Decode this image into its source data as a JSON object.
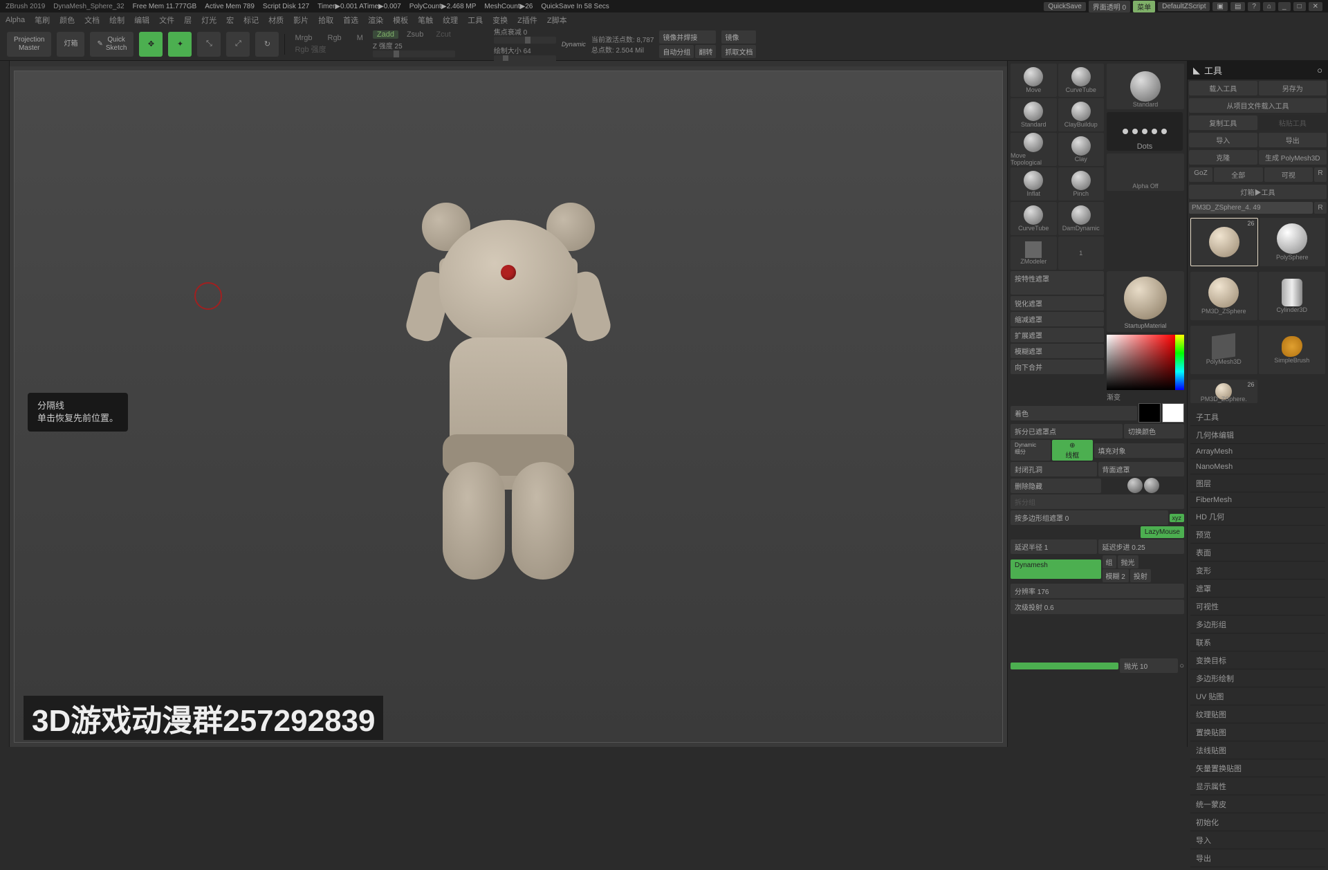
{
  "status": {
    "app": "ZBrush 2019",
    "doc": "DynaMesh_Sphere_32",
    "freemem": "Free Mem 11.777GB",
    "activemem": "Active Mem 789",
    "scratch": "Script Disk 127",
    "timer": "Timer▶0.001  ATime▶0.007",
    "polycount": "PolyCount▶2.468 MP",
    "meshcount": "MeshCount▶26",
    "quicksave": "QuickSave In 58 Secs",
    "quicksave_btn": "QuickSave",
    "transparent": "界面透明 0",
    "menu_btn": "菜单",
    "zscript": "DefaultZScript"
  },
  "menus": [
    "Alpha",
    "笔刷",
    "颜色",
    "文档",
    "绘制",
    "编辑",
    "文件",
    "层",
    "灯光",
    "宏",
    "标记",
    "材质",
    "影片",
    "拾取",
    "首选",
    "渲染",
    "模板",
    "笔触",
    "纹理",
    "工具",
    "变换",
    "Z插件",
    "Z脚本"
  ],
  "toolbar": {
    "projection": "Projection\nMaster",
    "lightbox": "灯箱",
    "quicksketch": "Quick\nSketch",
    "mrgb": "Mrgb",
    "rgb": "Rgb",
    "m": "M",
    "zadd": "Zadd",
    "zsub": "Zsub",
    "zcut": "Zcut",
    "rgb_intensity": "Rgb 强度",
    "z_intensity": "Z 强度 25",
    "focal": "焦点衰减 0",
    "drawsize": "绘制大小 64",
    "dynamic": "Dynamic",
    "activepoints": "当前激活点数: 8,787",
    "totalpoints": "总点数: 2.504 Mil",
    "mirror": "镜像并焊接",
    "autogroup": "自动分组",
    "flip": "翻转",
    "capture": "抓取文档",
    "mirror2": "镜像"
  },
  "tooltip": {
    "title": "分隔线",
    "desc": "单击恢复先前位置。"
  },
  "watermark": "3D游戏动漫群257292839",
  "brushes": {
    "row1a": "Move",
    "row1b": "CurveTube",
    "row2a": "Standard",
    "row2b": "ClayBuildup",
    "row3a": "Move Topological",
    "row3b": "Clay",
    "row4a": "Inflat",
    "row4b": "Pinch",
    "row5a": "CurveTube",
    "row5b": "DamDynamic",
    "row6a": "ZModeler",
    "row6b": "1",
    "standard": "Standard",
    "dots": "Dots",
    "alpha": "Alpha Off",
    "material": "StartupMaterial"
  },
  "mask_buttons": [
    "按特性遮罩",
    "锐化遮罩",
    "缩减遮罩",
    "扩展遮罩",
    "模糊遮罩",
    "向下合并"
  ],
  "rp1": {
    "gradient": "渐变",
    "tint": "着色",
    "split": "拆分已遮罩点",
    "switch": "切换颜色",
    "fill": "填充对象",
    "close_holes": "封闭孔洞",
    "del_hidden": "删除隐藏",
    "back_mask": "背面遮罩",
    "polygroup_mask": "按多边形组遮罩 0",
    "lazy": "LazyMouse",
    "lazy_radius": "延迟半径 1",
    "lazy_step": "延迟步进 0.25",
    "dynamesh": "Dynamesh",
    "group": "组",
    "polish": "抛光",
    "blur": "模糊 2",
    "project": "投射",
    "resolution": "分辨率 176",
    "subproject": "次级投射 0.6",
    "polish_label": "抛光 10",
    "xyz": "xyz"
  },
  "tool_panel": {
    "header": "工具",
    "load": "载入工具",
    "save": "另存为",
    "import_project": "从项目文件载入工具",
    "copy": "复制工具",
    "paste": "粘贴工具",
    "import": "导入",
    "export": "导出",
    "clone": "克隆",
    "polymesh3d": "生成 PolyMesh3D",
    "goz": "GoZ",
    "all": "全部",
    "visible": "可视",
    "r": "R",
    "lightbox_tools": "灯箱▶工具",
    "active_tool": "PM3D_ZSphere_4. 49",
    "badge_r": "R",
    "thumbs": [
      {
        "name": "",
        "badge": "26"
      },
      {
        "name": "PolySphere"
      },
      {
        "name": "PM3D_ZSphere"
      },
      {
        "name": "Cylinder3D"
      },
      {
        "name": "PolyMesh3D"
      },
      {
        "name": "SimpleBrush"
      },
      {
        "name": "PM3D_ZSphere.",
        "badge": "26"
      }
    ],
    "list": [
      "子工具",
      "几何体编辑",
      "ArrayMesh",
      "NanoMesh",
      "图层",
      "FiberMesh",
      "HD 几何",
      "预览",
      "表面",
      "变形",
      "遮罩",
      "可视性",
      "多边形组",
      "联系",
      "变换目标",
      "多边形绘制",
      "UV 贴图",
      "纹理贴图",
      "置换贴图",
      "法线贴图",
      "矢量置换贴图",
      "显示属性",
      "统一蒙皮",
      "初始化",
      "导入",
      "导出"
    ]
  }
}
